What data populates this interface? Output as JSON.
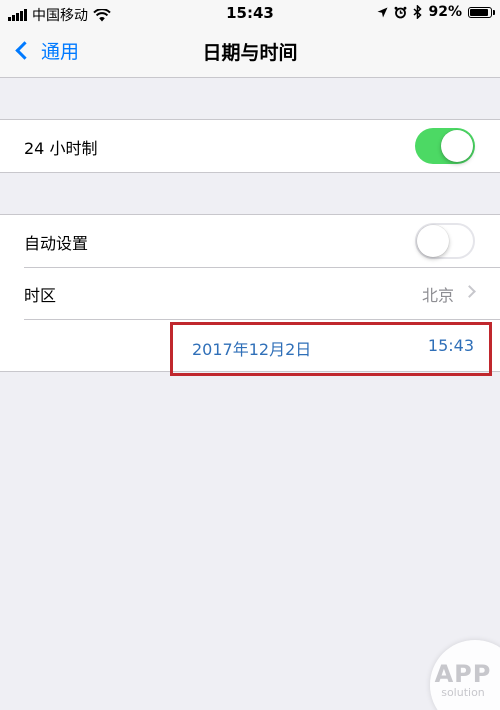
{
  "status_bar": {
    "carrier": "中国移动",
    "time": "15:43",
    "battery": "92%",
    "battery_level": 0.92
  },
  "nav": {
    "back_label": "通用",
    "title": "日期与时间"
  },
  "settings": {
    "hour24": {
      "label": "24 小时制",
      "on": true
    },
    "auto_set": {
      "label": "自动设置",
      "on": false
    },
    "timezone": {
      "label": "时区",
      "value": "北京"
    },
    "date": "2017年12月2日",
    "time": "15:43"
  },
  "watermark": {
    "big": "APP",
    "small": "solution"
  },
  "colors": {
    "accent": "#007aff",
    "toggle_on": "#4cd964",
    "highlight": "#c0272d"
  }
}
